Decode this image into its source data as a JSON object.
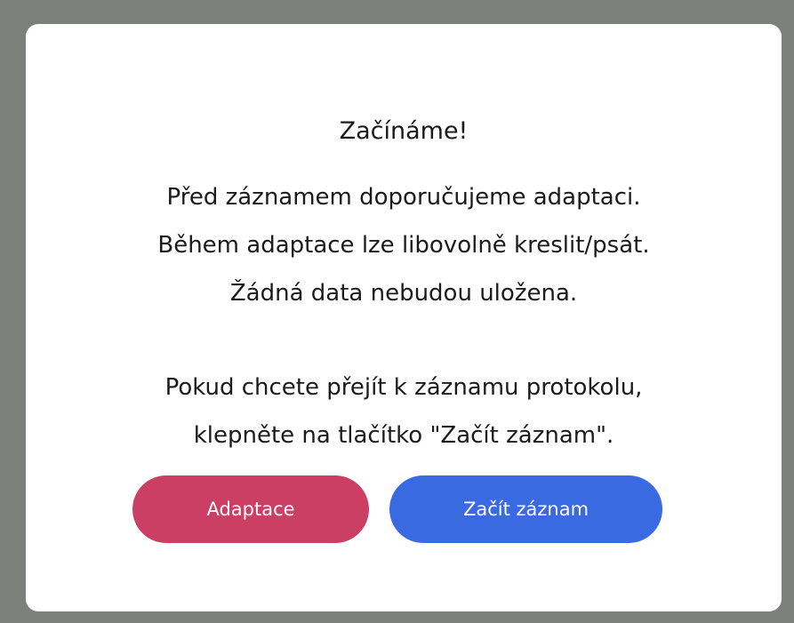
{
  "dialog": {
    "title": "Začínáme!",
    "paragraph1": [
      "Před záznamem doporučujeme adaptaci.",
      "Během adaptace lze libovolně kreslit/psát.",
      "Žádná data nebudou uložena."
    ],
    "paragraph2": [
      "Pokud chcete přejít k záznamu protokolu,",
      "klepněte na tlačítko \"Začít záznam\"."
    ],
    "buttons": {
      "adaptation_label": "Adaptace",
      "start_recording_label": "Začít záznam"
    }
  },
  "colors": {
    "backdrop": "#7d7f7a",
    "dialog_background": "#ffffff",
    "adaptation_button": "#cb3f65",
    "start_recording_button": "#3a6ae2"
  }
}
